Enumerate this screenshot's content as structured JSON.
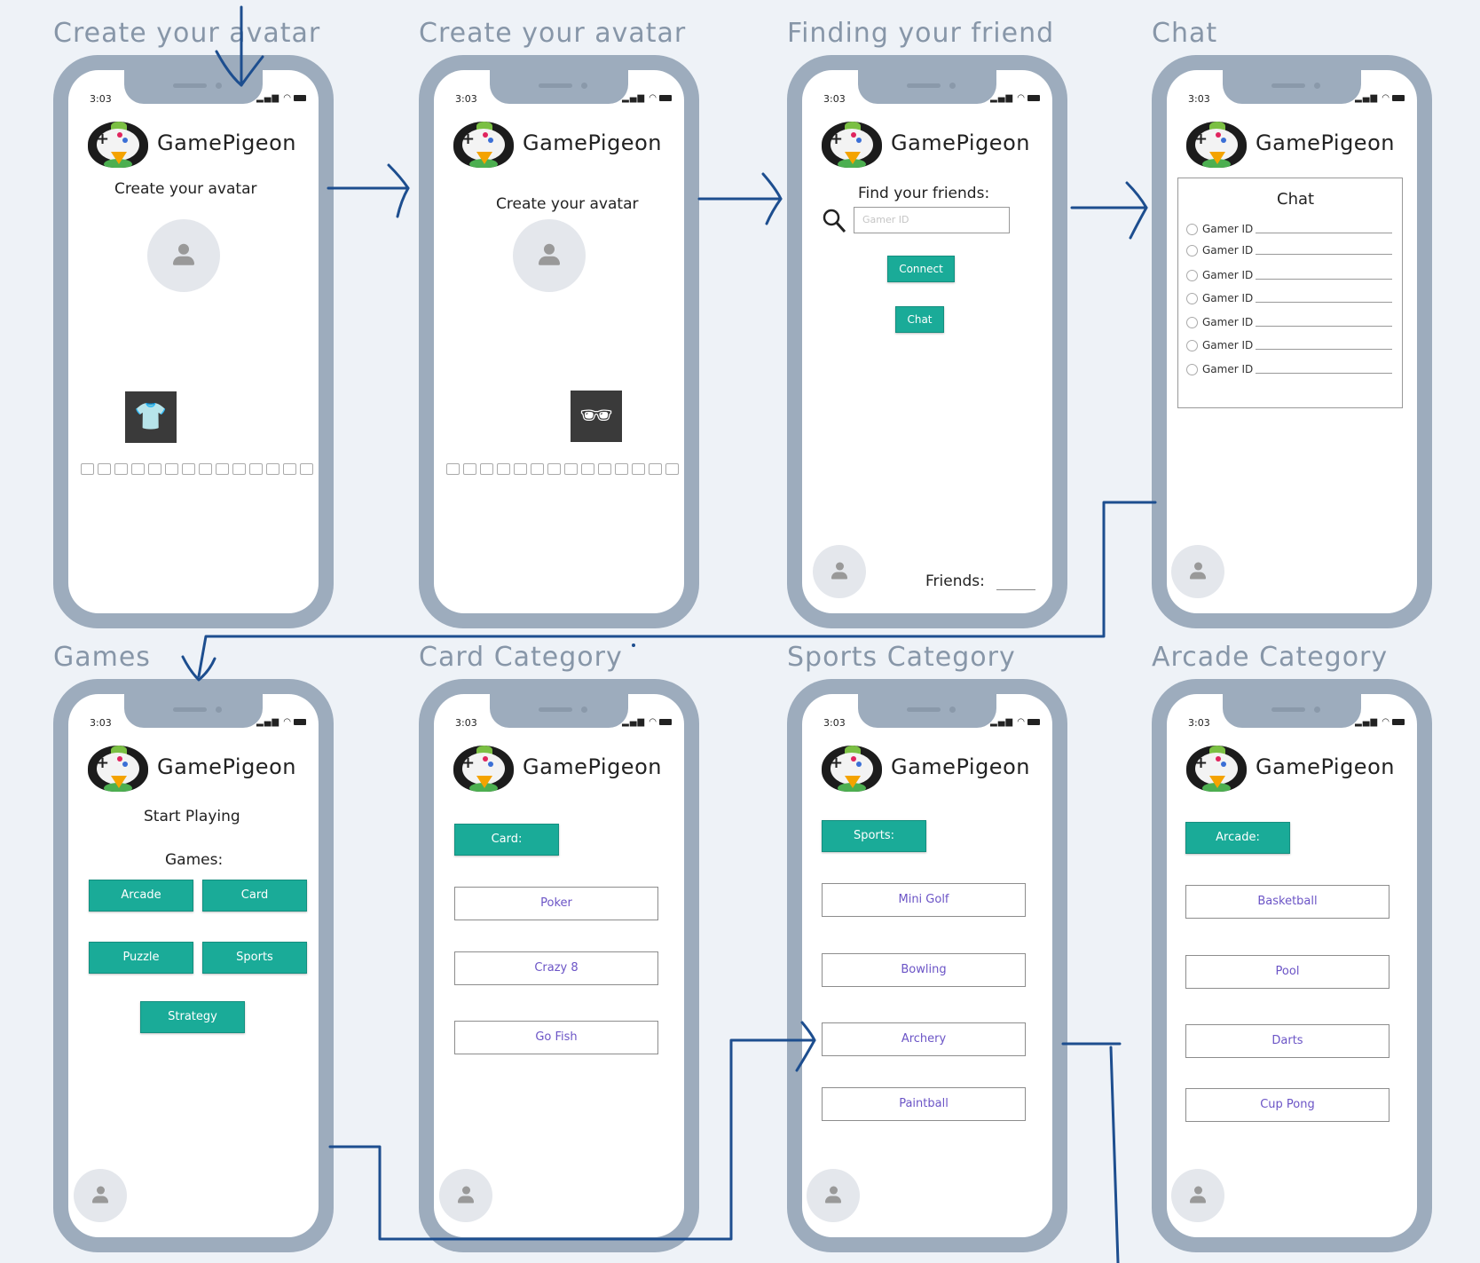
{
  "frames": [
    {
      "title": "Create your avatar"
    },
    {
      "title": "Create your avatar"
    },
    {
      "title": "Finding your friend"
    },
    {
      "title": "Chat"
    },
    {
      "title": "Games"
    },
    {
      "title": "Card Category"
    },
    {
      "title": "Sports Category"
    },
    {
      "title": "Arcade Category"
    }
  ],
  "phone": {
    "time": "3:03",
    "status_icons": "▂▄▆ ◠",
    "app_name": "GamePigeon"
  },
  "avatar1": {
    "heading": "Create your avatar",
    "item_icon": "tshirt-icon",
    "item_glyph": "👕"
  },
  "avatar2": {
    "heading": "Create your avatar",
    "item_icon": "hat-glasses-icon",
    "item_glyph": "🕶"
  },
  "friends": {
    "heading": "Find your friends:",
    "search_placeholder": "Gamer ID",
    "search_icon": "magnifier-icon",
    "connect_label": "Connect",
    "chat_label": "Chat",
    "friends_label": "Friends:"
  },
  "chat": {
    "heading": "Chat",
    "rows": [
      "Gamer ID",
      "Gamer ID",
      "Gamer ID",
      "Gamer ID",
      "Gamer ID",
      "Gamer ID",
      "Gamer ID"
    ]
  },
  "games": {
    "heading": "Start Playing",
    "subheading": "Games:",
    "buttons": [
      "Arcade",
      "Card",
      "Puzzle",
      "Sports",
      "Strategy"
    ]
  },
  "card": {
    "category_label": "Card:",
    "games": [
      "Poker",
      "Crazy 8",
      "Go Fish"
    ]
  },
  "sports": {
    "category_label": "Sports:",
    "games": [
      "Mini Golf",
      "Bowling",
      "Archery",
      "Paintball"
    ]
  },
  "arcade": {
    "category_label": "Arcade:",
    "games": [
      "Basketball",
      "Pool",
      "Darts",
      "Cup Pong"
    ]
  },
  "colors": {
    "teal": "#1aab98",
    "phone_frame": "#9dacbd",
    "arrow": "#1d4e8f",
    "title": "#8796a8"
  }
}
